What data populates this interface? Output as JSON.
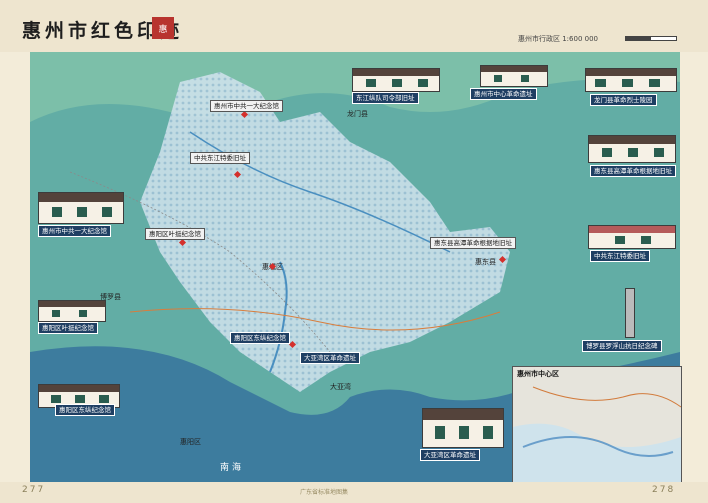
{
  "header": {
    "title": "惠州市红色印迹",
    "seal_text": "惠",
    "scale_text": "惠州市行政区 1:600 000"
  },
  "inset": {
    "title": "惠州市中心区"
  },
  "places": {
    "huicheng": "惠城区",
    "daya_bay": "大亚湾",
    "huidong": "惠东县",
    "boluo": "博罗县",
    "huiyang": "惠阳区",
    "longmen": "龙门县",
    "sea": "南海"
  },
  "footer": {
    "left_page": "277",
    "right_page": "278",
    "mid": "广东省标准地图集"
  },
  "sites": [
    {
      "label": "惠州市中共一大纪念馆"
    },
    {
      "label": "惠阳区叶挺纪念馆"
    },
    {
      "label": "东江纵队司令部旧址"
    },
    {
      "label": "博罗县罗浮山抗日纪念碑"
    },
    {
      "label": "惠东县高潭革命根据地旧址"
    },
    {
      "label": "龙门县革命烈士陵园"
    },
    {
      "label": "中共东江特委旧址"
    },
    {
      "label": "惠阳区东纵纪念馆"
    },
    {
      "label": "大亚湾区革命遗址"
    },
    {
      "label": "惠州市中心革命遗址"
    }
  ],
  "colors": {
    "sea": "#3f7ea0",
    "land": "#63b0a8",
    "highlight": "#d7e6f0",
    "callout": "#1f3f63"
  }
}
